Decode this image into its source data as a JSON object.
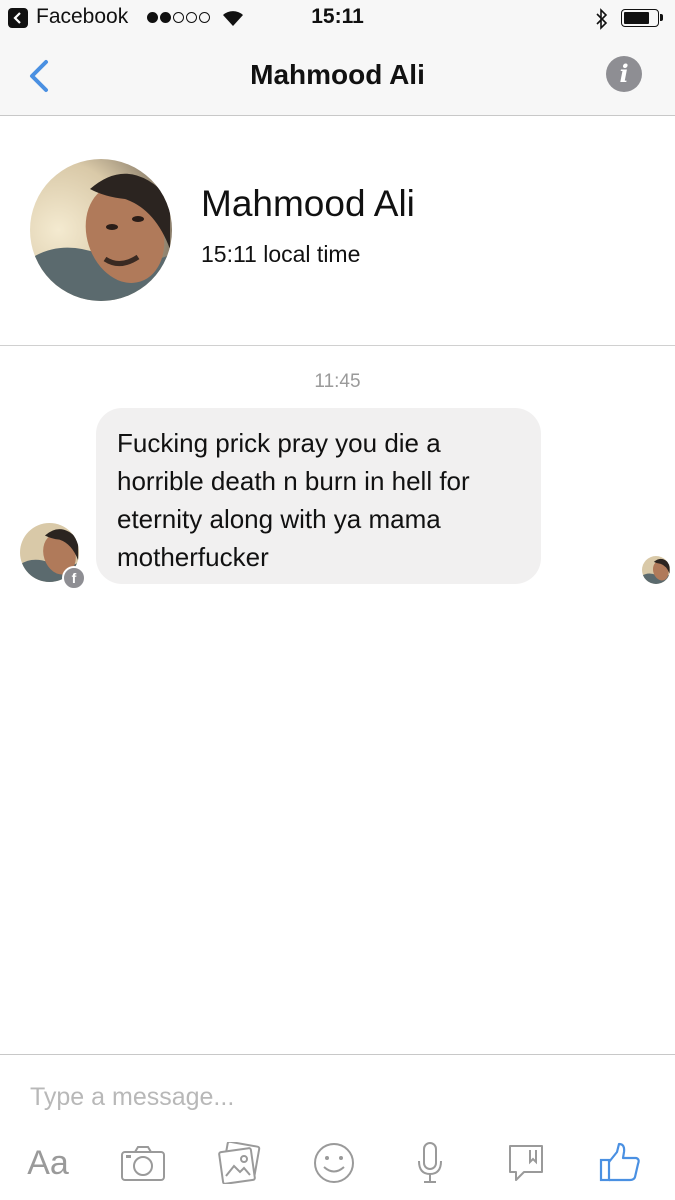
{
  "status_bar": {
    "app_name": "Facebook",
    "time": "15:11",
    "signal_bars_filled": 2,
    "signal_bars_total": 5
  },
  "nav": {
    "title": "Mahmood Ali",
    "back_icon": "chevron-left-icon",
    "info_icon": "info-icon",
    "accent_color": "#4a90e2"
  },
  "profile": {
    "name": "Mahmood Ali",
    "local_time": "15:11 local time"
  },
  "conversation": {
    "timestamp": "11:45",
    "messages": [
      {
        "sender": "Mahmood Ali",
        "lines": [
          "Fucking prick pray you die a",
          "horrible death n burn in hell for",
          "eternity along with ya mama",
          "motherfucker"
        ]
      }
    ]
  },
  "composer": {
    "placeholder": "Type a message...",
    "aa_label": "Aa",
    "tools": [
      "text-format-icon",
      "camera-icon",
      "photo-gallery-icon",
      "emoji-icon",
      "microphone-icon",
      "sticker-icon",
      "thumbs-up-icon"
    ],
    "like_color": "#4a90e2"
  }
}
